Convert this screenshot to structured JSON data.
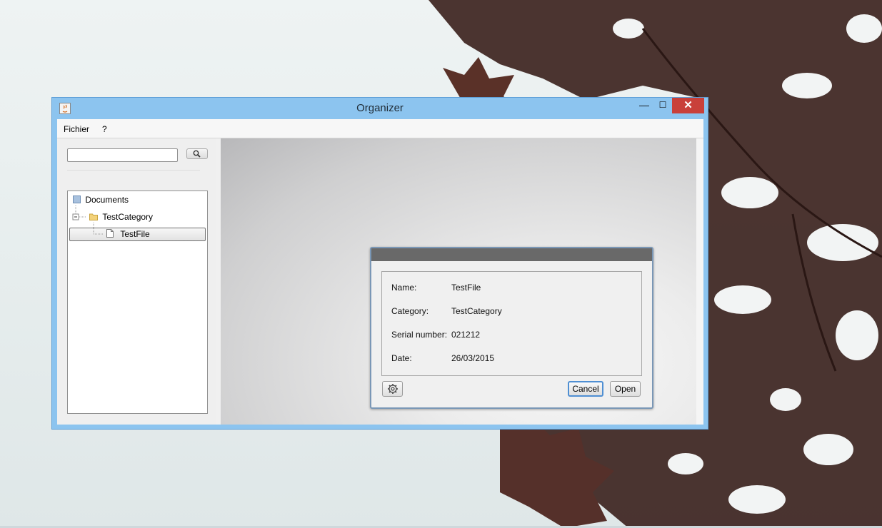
{
  "window": {
    "title": "Organizer",
    "close_glyph": "✕",
    "min_glyph": "—",
    "max_glyph": "☐"
  },
  "menu": {
    "items": [
      {
        "label": "Fichier"
      },
      {
        "label": "?"
      }
    ]
  },
  "search": {
    "value": "",
    "button_icon": "search-icon"
  },
  "tree": {
    "nodes": [
      {
        "label": "Documents",
        "icon": "root-icon"
      },
      {
        "label": "TestCategory",
        "icon": "folder-icon"
      },
      {
        "label": "TestFile",
        "icon": "file-icon",
        "selected": true
      }
    ]
  },
  "dialog": {
    "fields": [
      {
        "label": "Name:",
        "value": "TestFile"
      },
      {
        "label": "Category:",
        "value": "TestCategory"
      },
      {
        "label": "Serial number:",
        "value": "021212"
      },
      {
        "label": "Date:",
        "value": "26/03/2015"
      }
    ],
    "cancel_label": "Cancel",
    "open_label": "Open",
    "settings_icon": "gear-icon"
  },
  "colors": {
    "window_border": "#8cc4ef",
    "close_button": "#c9403a",
    "dialog_title": "#696969"
  }
}
